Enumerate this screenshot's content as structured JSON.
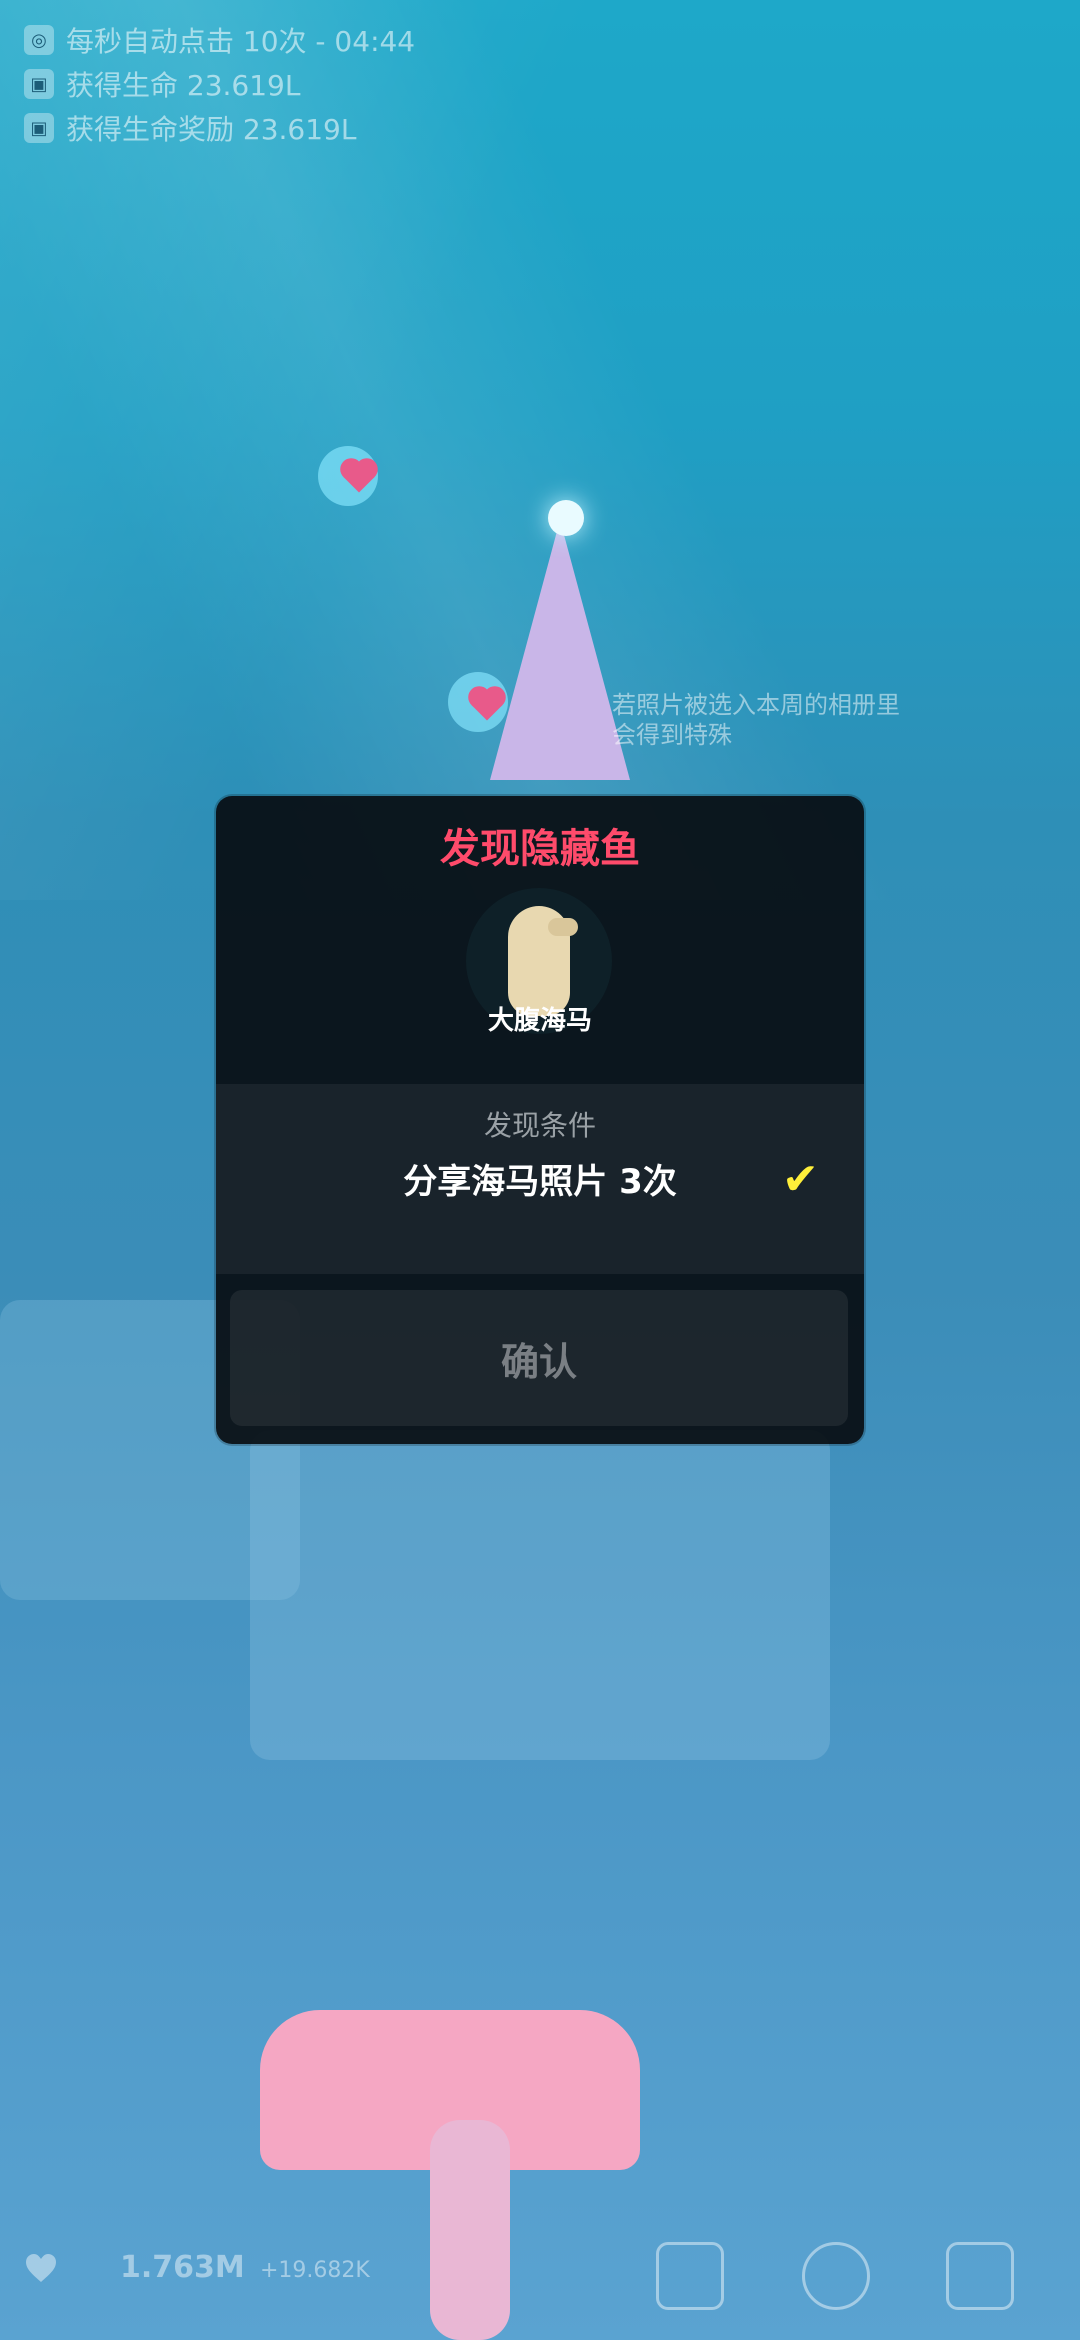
{
  "status": {
    "line1": "每秒自动点击 10次 - 04:44",
    "line2": "获得生命 23.619L",
    "line3": "获得生命奖励 23.619L"
  },
  "bg_hint": {
    "line1": "若照片被选入本周的相册里",
    "line2": "会得到特殊"
  },
  "modal": {
    "title": "发现隐藏鱼",
    "fish_name": "大腹海马",
    "condition_label": "发现条件",
    "condition_text": "分享海马照片 3次",
    "check_icon": "✔",
    "confirm_label": "确认"
  },
  "bottom_bar": {
    "life_total": "1.763M",
    "life_rate": "+19.682K",
    "icons": [
      "heart-icon",
      "camera-icon",
      "palette-icon",
      "list-icon"
    ]
  },
  "colors": {
    "title_red": "#ff4b6b",
    "check_yellow": "#ffef3a",
    "water": "#1ea8c9"
  }
}
